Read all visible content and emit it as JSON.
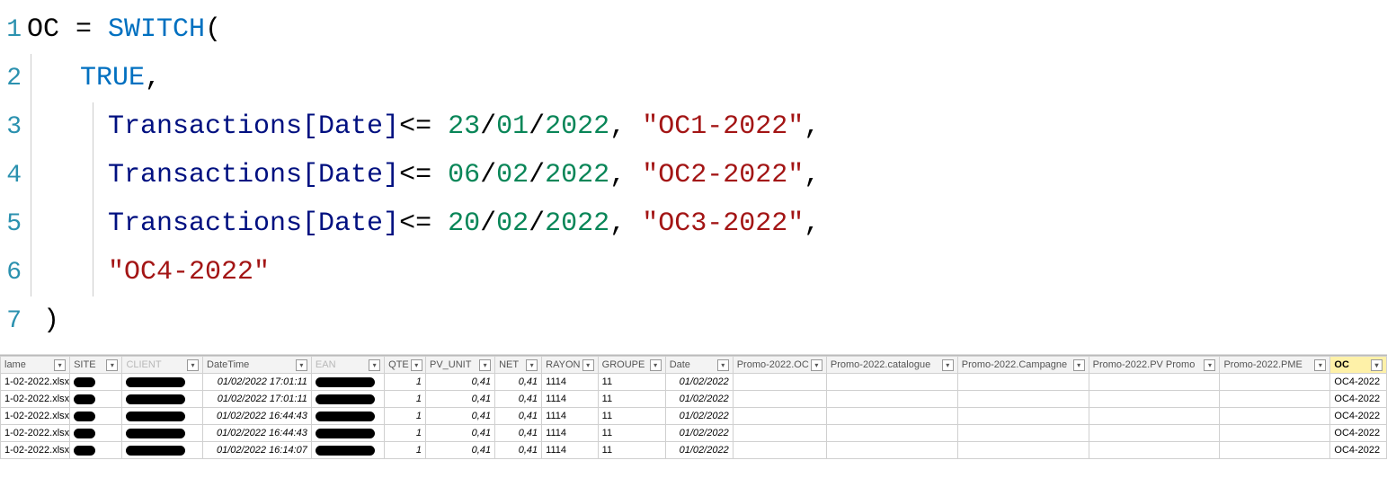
{
  "formula": {
    "lines": [
      "1",
      "2",
      "3",
      "4",
      "5",
      "6",
      "7"
    ],
    "measure_name": "OC",
    "eq": " = ",
    "switch_kw": "SWITCH",
    "open_paren": "(",
    "true_kw": "TRUE",
    "comma": ",",
    "col_ref": "Transactions[Date]",
    "le_op": "<=",
    "d1": "23",
    "m1": "01",
    "y1": "2022",
    "s1": "\"OC1-2022\"",
    "d2": "06",
    "m2": "02",
    "y2": "2022",
    "s2": "\"OC2-2022\"",
    "d3": "20",
    "m3": "02",
    "y3": "2022",
    "s3": "\"OC3-2022\"",
    "default_s": "\"OC4-2022\"",
    "slash": "/",
    "close_paren": ")"
  },
  "grid": {
    "headers": [
      {
        "label": "lame",
        "dim": false
      },
      {
        "label": "SITE",
        "dim": false
      },
      {
        "label": "CLIENT",
        "dim": true
      },
      {
        "label": "DateTime",
        "dim": false
      },
      {
        "label": "EAN",
        "dim": true
      },
      {
        "label": "QTE",
        "dim": false
      },
      {
        "label": "PV_UNIT",
        "dim": false
      },
      {
        "label": "NET",
        "dim": false
      },
      {
        "label": "RAYON",
        "dim": false
      },
      {
        "label": "GROUPE",
        "dim": false
      },
      {
        "label": "Date",
        "dim": false
      },
      {
        "label": "Promo-2022.OC",
        "dim": false
      },
      {
        "label": "Promo-2022.catalogue",
        "dim": false
      },
      {
        "label": "Promo-2022.Campagne",
        "dim": false
      },
      {
        "label": "Promo-2022.PV Promo",
        "dim": false
      },
      {
        "label": "Promo-2022.PME",
        "dim": false
      },
      {
        "label": "OC",
        "dim": false,
        "selected": true
      }
    ],
    "rows": [
      {
        "name": "1-02-2022.xlsx",
        "dt": "01/02/2022 17:01:11",
        "qte": "1",
        "pv": "0,41",
        "net": "0,41",
        "rayon": "1114",
        "groupe": "11",
        "date": "01/02/2022",
        "oc": "OC4-2022"
      },
      {
        "name": "1-02-2022.xlsx",
        "dt": "01/02/2022 17:01:11",
        "qte": "1",
        "pv": "0,41",
        "net": "0,41",
        "rayon": "1114",
        "groupe": "11",
        "date": "01/02/2022",
        "oc": "OC4-2022"
      },
      {
        "name": "1-02-2022.xlsx",
        "dt": "01/02/2022 16:44:43",
        "qte": "1",
        "pv": "0,41",
        "net": "0,41",
        "rayon": "1114",
        "groupe": "11",
        "date": "01/02/2022",
        "oc": "OC4-2022"
      },
      {
        "name": "1-02-2022.xlsx",
        "dt": "01/02/2022 16:44:43",
        "qte": "1",
        "pv": "0,41",
        "net": "0,41",
        "rayon": "1114",
        "groupe": "11",
        "date": "01/02/2022",
        "oc": "OC4-2022"
      },
      {
        "name": "1-02-2022.xlsx",
        "dt": "01/02/2022 16:14:07",
        "qte": "1",
        "pv": "0,41",
        "net": "0,41",
        "rayon": "1114",
        "groupe": "11",
        "date": "01/02/2022",
        "oc": "OC4-2022"
      }
    ]
  }
}
